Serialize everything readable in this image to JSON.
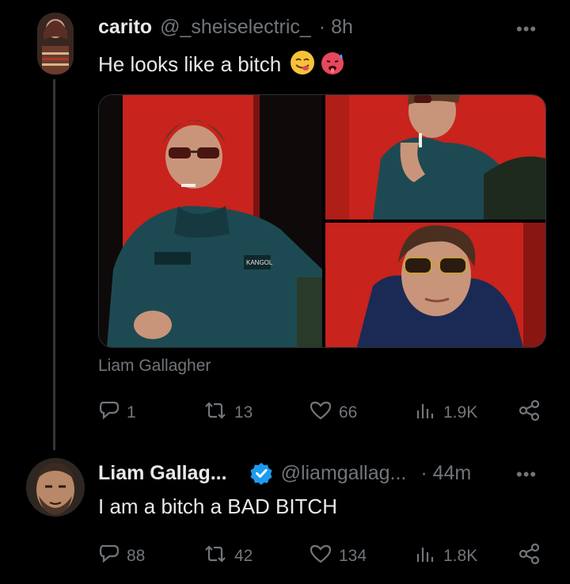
{
  "tweet1": {
    "name": "carito",
    "handle": "@_sheiselectric_",
    "time": "· 8h",
    "text": "He looks like a bitch",
    "emoji": [
      "face-savoring-food",
      "hot-face"
    ],
    "media_caption": "Liam Gallagher",
    "jacket_text": "KANGOL",
    "actions": {
      "replies": "1",
      "reposts": "13",
      "likes": "66",
      "views": "1.9K"
    }
  },
  "tweet2": {
    "name": "Liam Gallag...",
    "handle": "@liamgallag...",
    "time": "· 44m",
    "text": "I am a bitch a BAD BITCH",
    "verified": true,
    "actions": {
      "replies": "88",
      "reposts": "42",
      "likes": "134",
      "views": "1.8K"
    }
  },
  "ui": {
    "more": "•••"
  },
  "colors": {
    "background": "#000000",
    "text": "#e7e9ea",
    "muted": "#71767b",
    "verified": "#1d9bf0",
    "photo_red": "#c8231c",
    "jacket": "#1d4a52"
  },
  "icons": [
    "reply-icon",
    "repost-icon",
    "like-icon",
    "views-icon",
    "share-icon",
    "verified-badge-icon",
    "more-icon"
  ]
}
